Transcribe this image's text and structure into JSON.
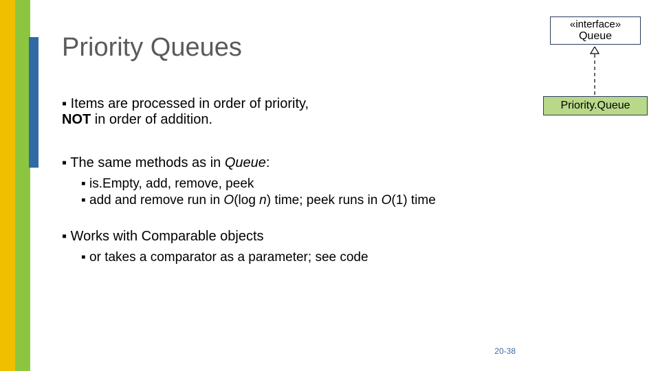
{
  "title": "Priority Queues",
  "uml": {
    "stereotype": "«interface»",
    "queue": "Queue",
    "priorityQueue": "Priority.Queue"
  },
  "bullets": {
    "b1a": "Items are processed in order of priority, ",
    "b1b": "NOT",
    "b1c": " in order of addition.",
    "b2a": "The same methods as in ",
    "b2b": "Queue",
    "b2c": ":",
    "s1": "is.Empty, add, remove, peek",
    "s2a": "add and remove run in ",
    "s2b": "O",
    "s2c": "(log ",
    "s2d": "n",
    "s2e": ") time; peek runs in ",
    "s2f": "O",
    "s2g": "(1) time",
    "b3": "Works with Comparable objects",
    "s3": "or takes a comparator as a parameter; see code"
  },
  "slidenum": "20-38"
}
